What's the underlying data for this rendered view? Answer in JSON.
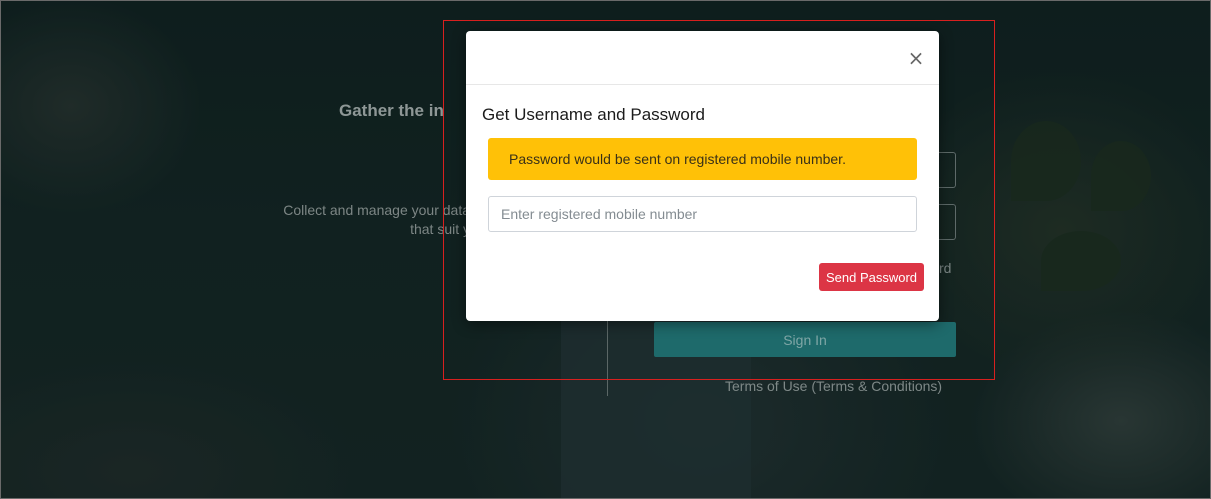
{
  "background": {
    "hero_title": "Gather the in",
    "hero_desc_line1": "Collect and manage your data",
    "hero_desc_line2": "that suit y",
    "forgot_fragment": "rd",
    "signin_label": "Sign In",
    "terms_label": "Terms of Use (Terms & Conditions)"
  },
  "modal": {
    "close_label": "×",
    "title": "Get Username and Password",
    "alert_text": "Password would be sent on registered mobile number.",
    "mobile_placeholder": "Enter registered mobile number",
    "mobile_value": "",
    "send_label": "Send Password"
  },
  "colors": {
    "alert": "#ffc107",
    "send_button": "#dc3545",
    "highlight_border": "#d8201f"
  }
}
